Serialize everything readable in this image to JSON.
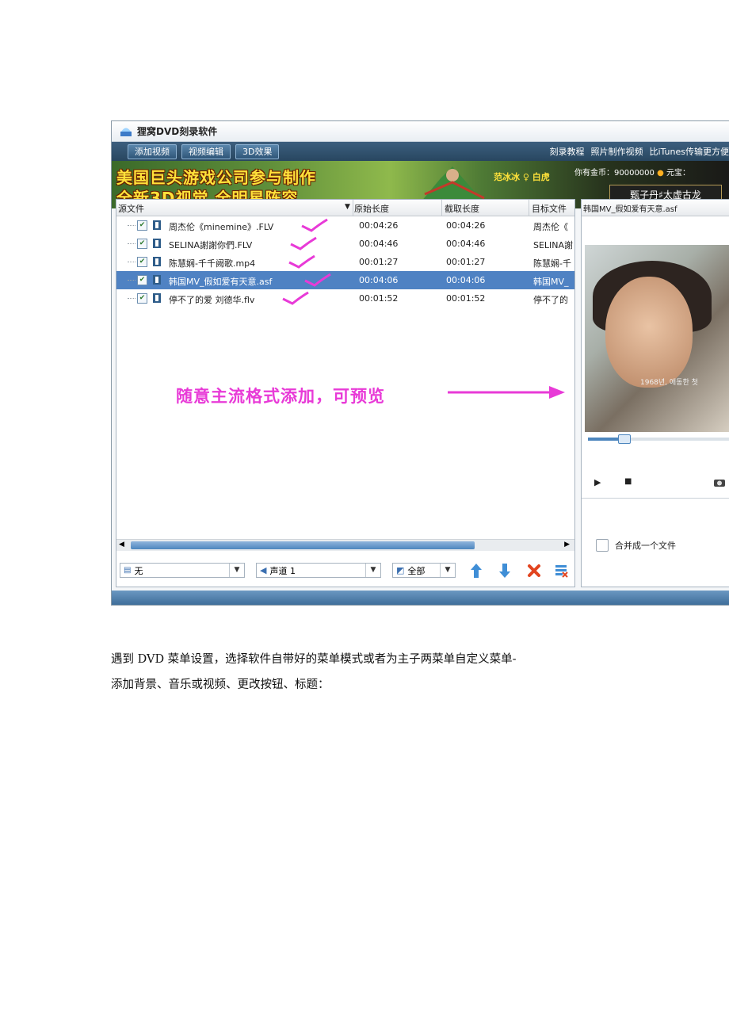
{
  "app": {
    "title": "狸窝DVD刻录软件",
    "toolbar": {
      "buttons": [
        "添加视频",
        "视频编辑",
        "3D效果"
      ],
      "links": [
        "刻录教程",
        "照片制作视频",
        "比iTunes传输更方便"
      ]
    },
    "banner": {
      "line1": "美国巨头游戏公司参与制作",
      "line2": "全新3D视觉 全明星阵容",
      "signature": "范冰冰 ♀ 白虎",
      "gold": "你有金币：90000000",
      "yuanbao": "元宝：",
      "name": "甄子丹♯太虚古龙"
    },
    "columns": {
      "source": "源文件",
      "orig_len": "原始长度",
      "cut_len": "截取长度",
      "target": "目标文件"
    },
    "files": [
      {
        "name": "周杰伦《minemine》.FLV",
        "orig": "00:04:26",
        "cut": "00:04:26",
        "target": "周杰伦《",
        "selected": false
      },
      {
        "name": "SELINA謝謝你們.FLV",
        "orig": "00:04:46",
        "cut": "00:04:46",
        "target": "SELINA謝",
        "selected": false
      },
      {
        "name": "陈慧娴-千千阙歌.mp4",
        "orig": "00:01:27",
        "cut": "00:01:27",
        "target": "陈慧娴-千",
        "selected": false
      },
      {
        "name": "韩国MV_假如爱有天意.asf",
        "orig": "00:04:06",
        "cut": "00:04:06",
        "target": "韩国MV_",
        "selected": true
      },
      {
        "name": "停不了的爱 刘德华.flv",
        "orig": "00:01:52",
        "cut": "00:01:52",
        "target": "停不了的",
        "selected": false
      }
    ],
    "annotation": "随意主流格式添加，可预览",
    "bottom": {
      "subtitle": "无",
      "audio": "声道 1",
      "range": "全部"
    },
    "preview": {
      "title": "韩国MV_假如爱有天意.asf",
      "overlay_text": "1968년, 애동한 첫",
      "progress": 0.25,
      "merge_label": "合并成一个文件"
    }
  },
  "paragraph": {
    "line1": "遇到 DVD 菜单设置，选择软件自带好的菜单模式或者为主子两菜单自定义菜单-",
    "line2": "添加背景、音乐或视频、更改按钮、标题："
  },
  "colors": {
    "selection": "#4f82c3",
    "annotation": "#e83ad7",
    "banner_text": "#ffe23a"
  }
}
